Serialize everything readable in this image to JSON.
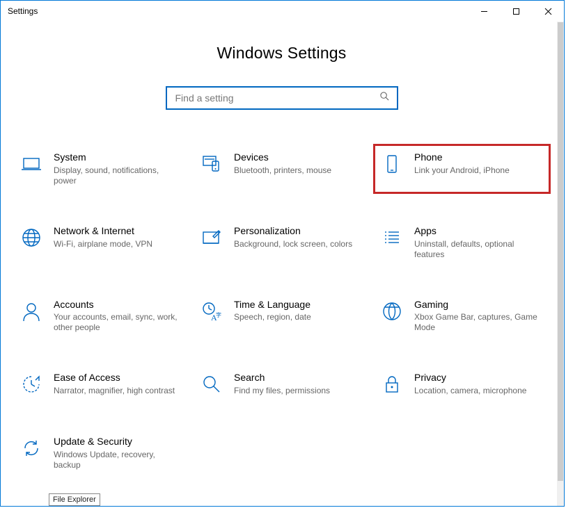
{
  "window_title": "Settings",
  "page_title": "Windows Settings",
  "search": {
    "placeholder": "Find a setting"
  },
  "tooltip": "File Explorer",
  "tiles": [
    {
      "id": "system",
      "title": "System",
      "sub": "Display, sound, notifications, power",
      "icon": "laptop-icon"
    },
    {
      "id": "devices",
      "title": "Devices",
      "sub": "Bluetooth, printers, mouse",
      "icon": "devices-icon"
    },
    {
      "id": "phone",
      "title": "Phone",
      "sub": "Link your Android, iPhone",
      "icon": "phone-icon",
      "highlight": true
    },
    {
      "id": "network",
      "title": "Network & Internet",
      "sub": "Wi-Fi, airplane mode, VPN",
      "icon": "globe-icon"
    },
    {
      "id": "personalization",
      "title": "Personalization",
      "sub": "Background, lock screen, colors",
      "icon": "personalization-icon"
    },
    {
      "id": "apps",
      "title": "Apps",
      "sub": "Uninstall, defaults, optional features",
      "icon": "apps-icon"
    },
    {
      "id": "accounts",
      "title": "Accounts",
      "sub": "Your accounts, email, sync, work, other people",
      "icon": "person-icon"
    },
    {
      "id": "time",
      "title": "Time & Language",
      "sub": "Speech, region, date",
      "icon": "time-lang-icon"
    },
    {
      "id": "gaming",
      "title": "Gaming",
      "sub": "Xbox Game Bar, captures, Game Mode",
      "icon": "gaming-icon"
    },
    {
      "id": "ease",
      "title": "Ease of Access",
      "sub": "Narrator, magnifier, high contrast",
      "icon": "ease-icon"
    },
    {
      "id": "search",
      "title": "Search",
      "sub": "Find my files, permissions",
      "icon": "search-tile-icon"
    },
    {
      "id": "privacy",
      "title": "Privacy",
      "sub": "Location, camera, microphone",
      "icon": "lock-icon"
    },
    {
      "id": "update",
      "title": "Update & Security",
      "sub": "Windows Update, recovery, backup",
      "icon": "update-icon"
    }
  ]
}
